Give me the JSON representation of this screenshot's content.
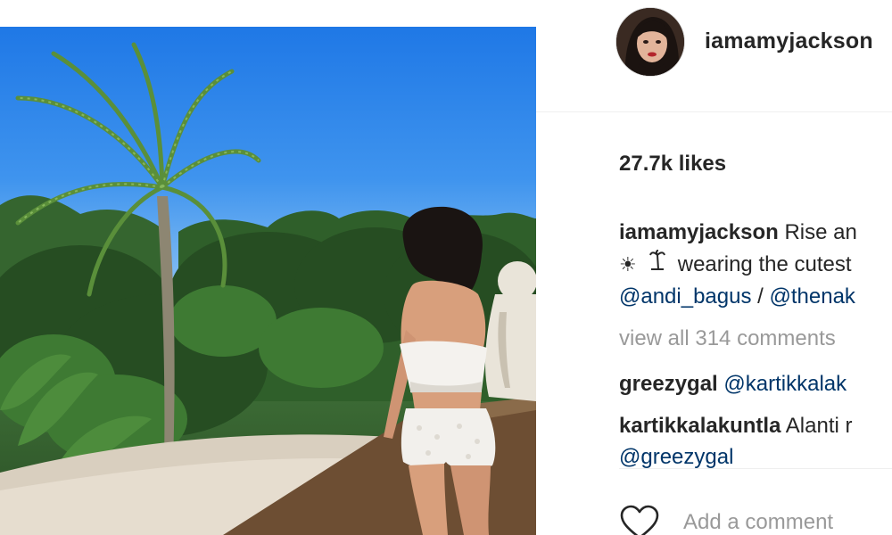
{
  "post": {
    "image_alt": "Woman in white lace outfit on a sunny terrace with palm trees"
  },
  "header": {
    "username": "iamamyjackson"
  },
  "likes": {
    "text": "27.7k likes"
  },
  "caption": {
    "username": "iamamyjackson",
    "text_line1": "Rise an",
    "emoji1": "☀",
    "emoji2": "🏝",
    "text_line2": "wearing the cutest",
    "mention1": "@andi_bagus",
    "separator": " / ",
    "mention2": "@thenak"
  },
  "comments": {
    "view_all": "view all 314 comments",
    "items": [
      {
        "username": "greezygal",
        "text": "@kartikkalak"
      },
      {
        "username": "kartikkalakuntla",
        "text": "Alanti r",
        "text_line2": "@greezygal"
      }
    ]
  },
  "actions": {
    "like_icon": "heart-icon",
    "comment_placeholder": "Add a comment"
  },
  "colors": {
    "text": "#262626",
    "mention": "#003569",
    "muted": "#999999",
    "divider": "#efefef"
  }
}
